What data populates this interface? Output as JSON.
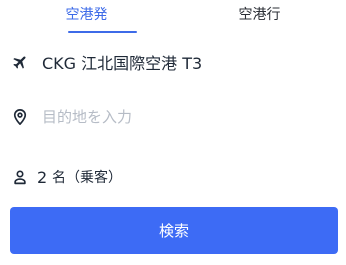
{
  "tabs": {
    "departure_label": "空港発",
    "arrival_label": "空港行"
  },
  "from": {
    "icon": "airplane-icon",
    "value": "CKG 江北国際空港 T3"
  },
  "destination": {
    "icon": "map-pin-icon",
    "placeholder": "目的地を入力"
  },
  "passengers": {
    "icon": "person-icon",
    "count": "2",
    "label": "名（乗客）"
  },
  "search_button": {
    "label": "検索"
  },
  "colors": {
    "accent": "#3d6be8",
    "button": "#3d6bf5",
    "placeholder": "#b6bcc6",
    "text": "#1f2937"
  }
}
